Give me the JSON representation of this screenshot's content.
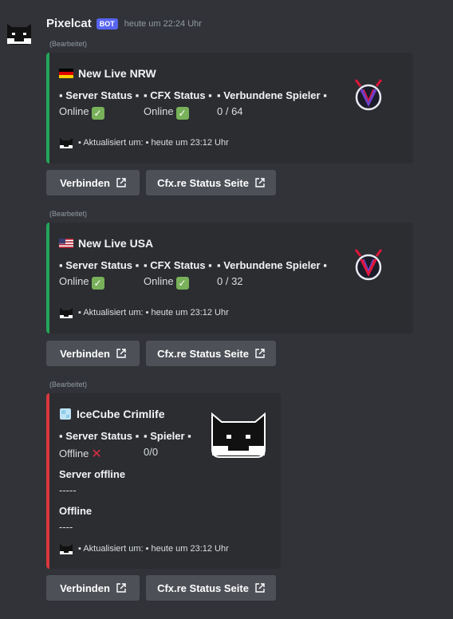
{
  "message": {
    "username": "Pixelcat",
    "badge": "BOT",
    "timestamp": "heute um 22:24 Uhr",
    "edited_label": "(Bearbeitet)"
  },
  "embeds": [
    {
      "flag": "flag-germany-icon",
      "title": "New Live NRW",
      "accent_color": "#23a55a",
      "fields": [
        {
          "name": "▪ Server Status ▪",
          "value": "Online"
        },
        {
          "name": "▪ CFX Status ▪",
          "value": "Online"
        },
        {
          "name": "▪ Verbundene Spieler ▪",
          "value": "0 / 64"
        }
      ],
      "footer": "▪ Aktualisiert um: ▪ heute um 23:12 Uhr"
    },
    {
      "flag": "flag-usa-icon",
      "title": "New Live USA",
      "accent_color": "#23a55a",
      "fields": [
        {
          "name": "▪ Server Status ▪",
          "value": "Online"
        },
        {
          "name": "▪ CFX Status ▪",
          "value": "Online"
        },
        {
          "name": "▪ Verbundene Spieler ▪",
          "value": "0 / 32"
        }
      ],
      "footer": "▪ Aktualisiert um: ▪ heute um 23:12 Uhr"
    },
    {
      "flag": "ice-cube-icon",
      "title": "IceCube Crimlife",
      "accent_color": "#da373c",
      "fields": [
        {
          "name": "▪ Server Status ▪",
          "value": "Offline"
        },
        {
          "name": "▪ Spieler ▪",
          "value": "0/0"
        }
      ],
      "extra_fields": [
        {
          "name": "Server offline",
          "value": "-----"
        },
        {
          "name": "Offline",
          "value": "----"
        }
      ],
      "footer": "▪ Aktualisiert um: ▪ heute um 23:12 Uhr"
    }
  ],
  "buttons": {
    "connect": "Verbinden",
    "status_page": "Cfx.re Status Seite"
  }
}
